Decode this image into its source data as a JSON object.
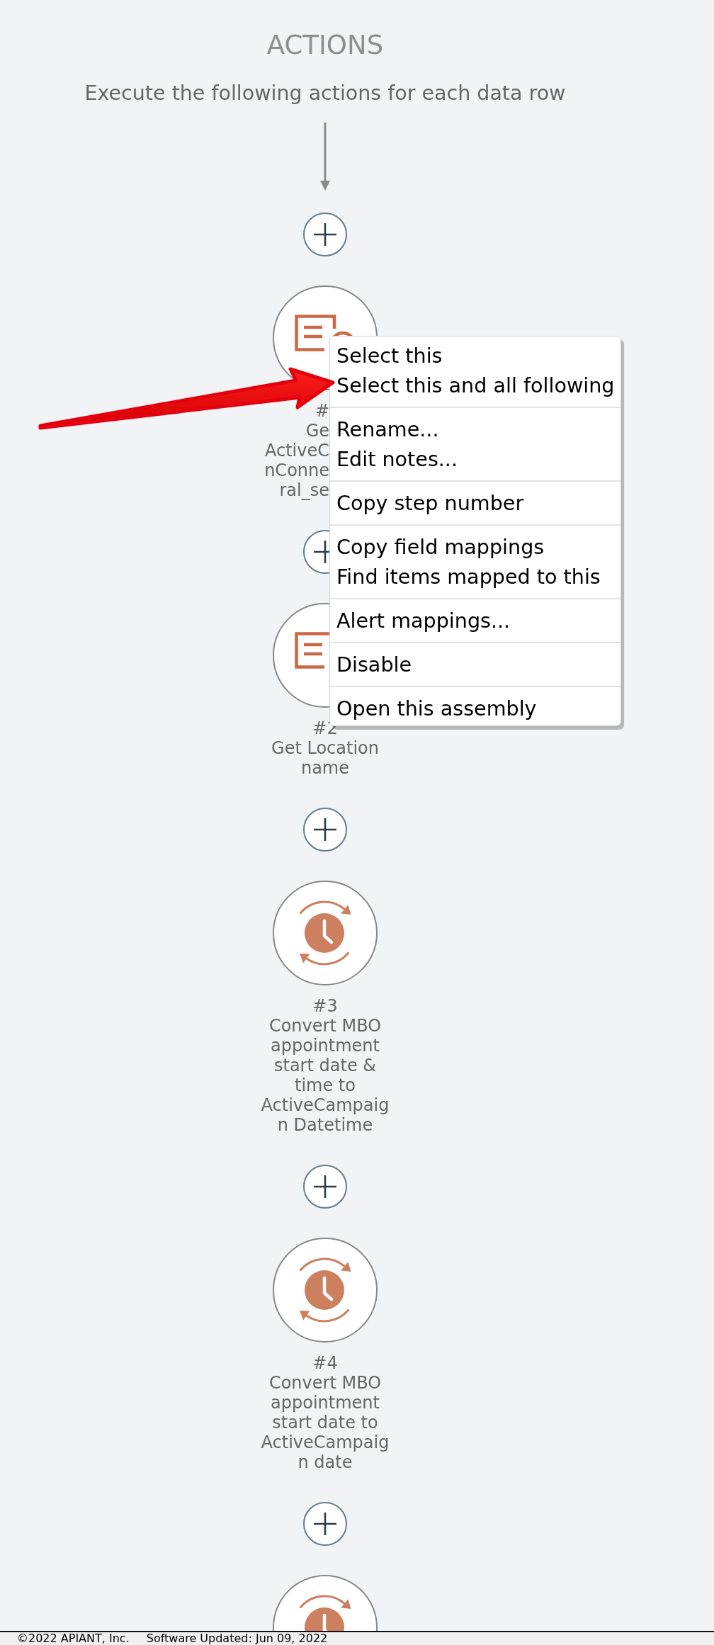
{
  "header": {
    "title": "ACTIONS",
    "subtitle": "Execute the following actions for each data row"
  },
  "steps": [
    {
      "kind": "document_search",
      "number": "#",
      "title_lines": [
        "Ge",
        "ActiveC",
        "nConne",
        "ral_se"
      ],
      "menu_open": true
    },
    {
      "kind": "document_search",
      "number": "#2",
      "title_lines": [
        "Get Location",
        "name"
      ],
      "menu_open": false
    },
    {
      "kind": "clock_sync",
      "number": "#3",
      "title_lines": [
        "Convert MBO",
        "appointment",
        "start date &",
        "time to",
        "ActiveCampaig",
        "n Datetime"
      ],
      "menu_open": false
    },
    {
      "kind": "clock_sync",
      "number": "#4",
      "title_lines": [
        "Convert MBO",
        "appointment",
        "start date to",
        "ActiveCampaig",
        "n date"
      ],
      "menu_open": false
    },
    {
      "kind": "clock_sync",
      "menu_open": false
    }
  ],
  "context_menu": {
    "groups": [
      [
        "Select this",
        "Select this and all following"
      ],
      [
        "Rename...",
        "Edit notes..."
      ],
      [
        "Copy step number"
      ],
      [
        "Copy field mappings",
        "Find items mapped to this"
      ],
      [
        "Alert mappings..."
      ],
      [
        "Disable"
      ],
      [
        "Open this assembly"
      ]
    ]
  },
  "footer": {
    "copyright": "©2022 APIANT, Inc.",
    "updated": "Software Updated: Jun 09, 2022"
  }
}
